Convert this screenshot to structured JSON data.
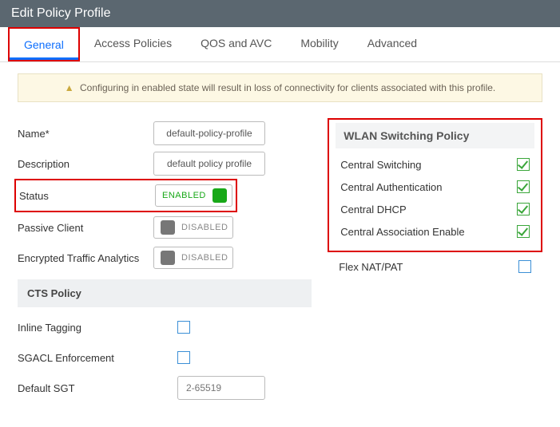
{
  "header": {
    "title": "Edit Policy Profile"
  },
  "tabs": {
    "general": "General",
    "access_policies": "Access Policies",
    "qos_avc": "QOS and AVC",
    "mobility": "Mobility",
    "advanced": "Advanced"
  },
  "warning": "Configuring in enabled state will result in loss of connectivity for clients associated with this profile.",
  "form": {
    "name_label": "Name*",
    "name_value": "default-policy-profile",
    "description_label": "Description",
    "description_value": "default policy profile",
    "status_label": "Status",
    "status_toggle": "ENABLED",
    "passive_client_label": "Passive Client",
    "passive_client_toggle": "DISABLED",
    "eta_label": "Encrypted Traffic Analytics",
    "eta_toggle": "DISABLED",
    "cts_header": "CTS Policy",
    "inline_tagging_label": "Inline Tagging",
    "sgacl_label": "SGACL Enforcement",
    "default_sgt_label": "Default SGT",
    "default_sgt_placeholder": "2-65519"
  },
  "wlan_panel": {
    "title": "WLAN Switching Policy",
    "central_switching": "Central Switching",
    "central_auth": "Central Authentication",
    "central_dhcp": "Central DHCP",
    "central_assoc": "Central Association Enable",
    "flex_nat": "Flex NAT/PAT"
  }
}
